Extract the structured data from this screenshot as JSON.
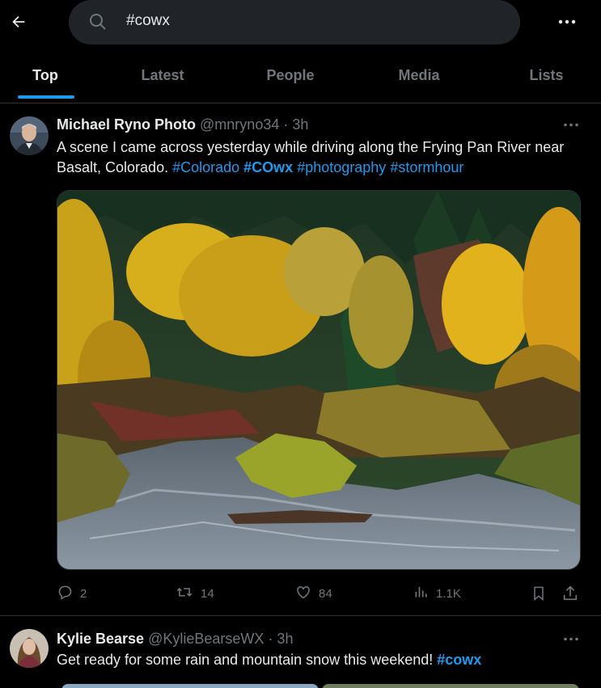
{
  "search": {
    "query": "#cowx"
  },
  "tabs": [
    {
      "label": "Top"
    },
    {
      "label": "Latest"
    },
    {
      "label": "People"
    },
    {
      "label": "Media"
    },
    {
      "label": "Lists"
    }
  ],
  "tweets": [
    {
      "name": "Michael Ryno Photo",
      "handle": "@mnryno34",
      "time": "· 3h",
      "text_prefix": "A scene I came across yesterday while driving along the Frying Pan River near Basalt, Colorado.",
      "hashtags": [
        "#Colorado",
        "#COwx",
        "#photography",
        "#stormhour"
      ],
      "actions": {
        "replies": "2",
        "reposts": "14",
        "likes": "84",
        "views": "1.1K"
      }
    },
    {
      "name": "Kylie Bearse",
      "handle": "@KylieBearseWX",
      "time": "· 3h",
      "text_prefix": "Get ready for some rain and mountain snow this weekend!",
      "hashtags": [
        "#cowx"
      ]
    }
  ],
  "colors": {
    "accent": "#1d9bf0",
    "muted": "#71767b",
    "text": "#e7e9ea",
    "border": "#2f3336"
  },
  "icons": [
    "back-arrow-icon",
    "search-icon",
    "more-icon",
    "reply-icon",
    "repost-icon",
    "like-icon",
    "views-icon",
    "bookmark-icon",
    "share-icon"
  ]
}
